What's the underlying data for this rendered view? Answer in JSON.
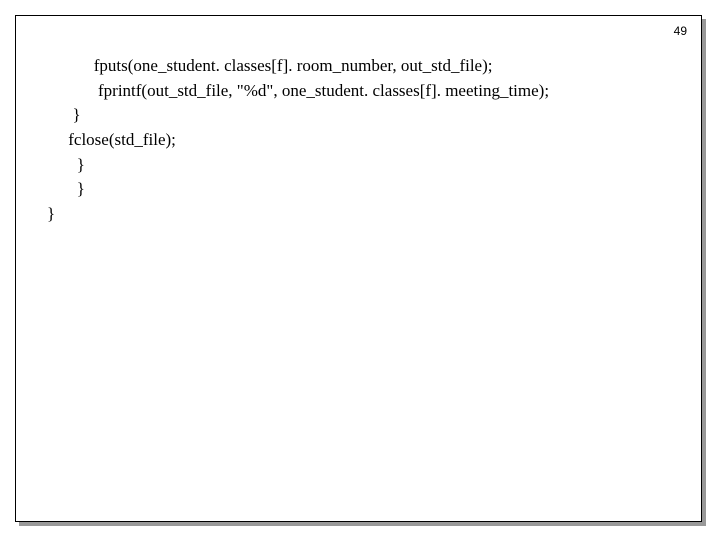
{
  "page_number": "49",
  "code": {
    "line1": "               fputs(one_student. classes[f]. room_number, out_std_file);",
    "line2": "                fprintf(out_std_file, \"%d\", one_student. classes[f]. meeting_time);",
    "line3": "          }",
    "line4": "         fclose(std_file);",
    "line5": "           }",
    "line6": "           }",
    "line7": "    }"
  }
}
